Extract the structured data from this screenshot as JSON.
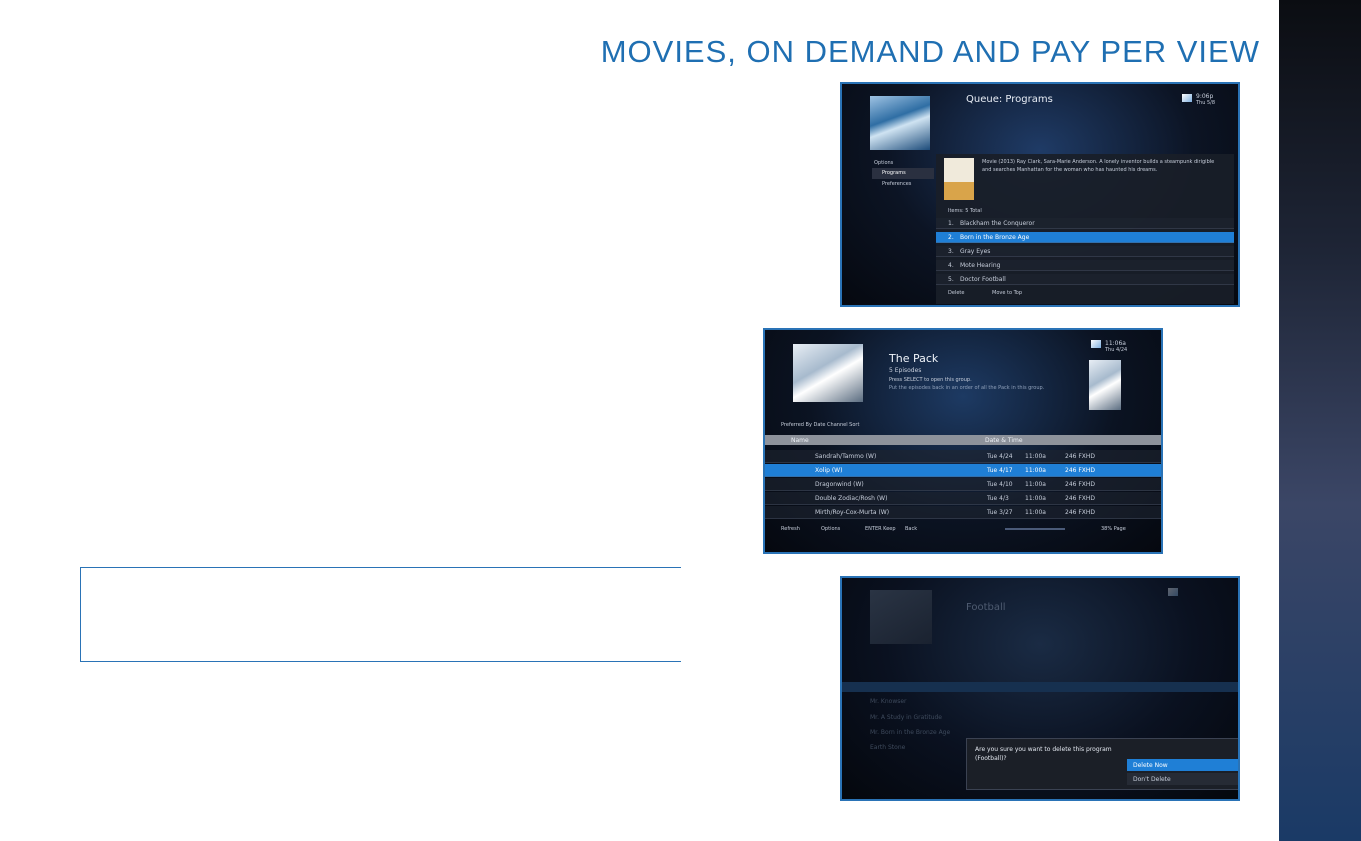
{
  "page_title": "MOVIES, ON DEMAND AND PAY PER VIEW",
  "shot1": {
    "header": "Queue: Programs",
    "time": "9:06p",
    "date": "Thu 5/8",
    "nav": [
      "Options",
      "Programs",
      "Preferences"
    ],
    "description": "Movie (2013) Ray Clark, Sara-Marie Anderson. A lonely inventor builds a steampunk dirigible and searches Manhattan for the woman who has haunted his dreams.",
    "count_label": "Items: 5 Total",
    "items": [
      {
        "num": "1.",
        "name": "Blackham the Conqueror"
      },
      {
        "num": "2.",
        "name": "Born in the Bronze Age"
      },
      {
        "num": "3.",
        "name": "Gray Eyes"
      },
      {
        "num": "4.",
        "name": "Mote Hearing"
      },
      {
        "num": "5.",
        "name": "Doctor Football"
      }
    ],
    "footer": [
      "Delete",
      "Move to Top"
    ]
  },
  "shot2": {
    "title": "The Pack",
    "subtitle": "5 Episodes",
    "hint": "Press SELECT to open this group.",
    "hint2": "Put the episodes back in an order of all the Pack in this group.",
    "time": "11:06a",
    "date": "Thu 4/24",
    "sort_label": "Preferred By Date Channel Sort",
    "col_header": "Name",
    "col_header2": "Date & Time",
    "rows": [
      {
        "name": "Sandrah/Tammo (W)",
        "date": "Tue 4/24",
        "time": "11:00a",
        "ch": "246 FXHD"
      },
      {
        "name": "Xolip (W)",
        "date": "Tue 4/17",
        "time": "11:00a",
        "ch": "246 FXHD"
      },
      {
        "name": "Dragonwind (W)",
        "date": "Tue 4/10",
        "time": "11:00a",
        "ch": "246 FXHD"
      },
      {
        "name": "Double Zodiac/Rosh (W)",
        "date": "Tue 4/3",
        "time": "11:00a",
        "ch": "246 FXHD"
      },
      {
        "name": "Mirth/Roy-Cox-Murta (W)",
        "date": "Tue 3/27",
        "time": "11:00a",
        "ch": "246 FXHD"
      }
    ],
    "footer": [
      "Refresh",
      "Options",
      "ENTER Keep",
      "Back"
    ],
    "page": "38% Page"
  },
  "shot3": {
    "title": "Football",
    "dialog_text": "Are you sure you want to delete this program (Football)?",
    "options": [
      "Delete Now",
      "Don't Delete"
    ],
    "rows": [
      "Mr. Knowser",
      "Mr. A Study in Gratitude",
      "Mr. Born in the Bronze Age",
      "Earth Stone"
    ]
  }
}
